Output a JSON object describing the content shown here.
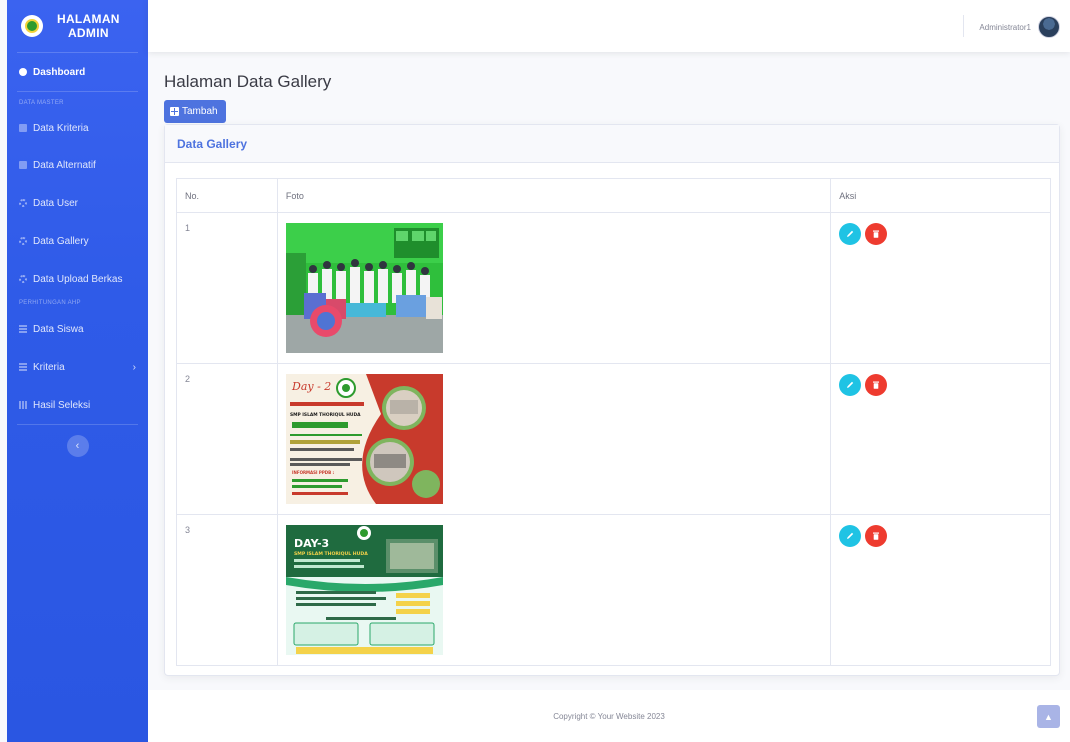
{
  "brand": {
    "line1": "HALAMAN",
    "line2": "ADMIN",
    "logo_icon": "school-logo-icon"
  },
  "sidebar": {
    "dashboard": "Dashboard",
    "section_master": "DATA MASTER",
    "items_master": [
      {
        "label": "Data Kriteria",
        "icon": "folder-icon"
      },
      {
        "label": "Data Alternatif",
        "icon": "folder-icon"
      },
      {
        "label": "Data User",
        "icon": "cog-icon"
      },
      {
        "label": "Data Gallery",
        "icon": "cog-icon"
      },
      {
        "label": "Data Upload Berkas",
        "icon": "cog-icon"
      }
    ],
    "section_ahp": "PERHITUNGAN AHP",
    "items_ahp": [
      {
        "label": "Data Siswa",
        "icon": "table-icon"
      },
      {
        "label": "Kriteria",
        "icon": "table-icon"
      },
      {
        "label": "Hasil Seleksi",
        "icon": "chart-icon"
      }
    ],
    "toggle_glyph": "‹",
    "chevron_glyph": "›"
  },
  "topbar": {
    "user_name": "Administrator1"
  },
  "page": {
    "title": "Halaman Data Gallery",
    "add_button": "Tambah"
  },
  "card": {
    "title": "Data Gallery"
  },
  "table": {
    "headers": {
      "no": "No.",
      "foto": "Foto",
      "aksi": "Aksi"
    },
    "rows": [
      {
        "no": "1",
        "photo": "group-photo-students"
      },
      {
        "no": "2",
        "photo": "poster-day-2"
      },
      {
        "no": "3",
        "photo": "poster-day-3"
      }
    ]
  },
  "poster2": {
    "day": "Day - 2",
    "school": "SMP ISLAM THORIQUL HUDA",
    "info": "INFORMASI PPDB :"
  },
  "poster3": {
    "day": "DAY-3",
    "school": "SMP ISLAM THORIQUL HUDA"
  },
  "footer": {
    "copyright": "Copyright © Your Website 2023"
  },
  "colors": {
    "sidebar": "#2f5be8",
    "primary": "#4e73df",
    "edit": "#1fc3e4",
    "delete": "#ee3b2f"
  }
}
